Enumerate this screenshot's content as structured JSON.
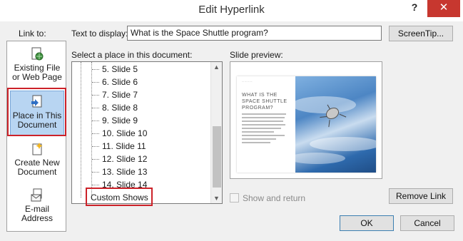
{
  "window": {
    "title": "Edit Hyperlink",
    "help_label": "?",
    "close_label": "✕"
  },
  "link_to": {
    "heading": "Link to:",
    "items": [
      {
        "label_line1": "Existing File",
        "label_line2": "or Web Page",
        "icon": "globe-file-icon",
        "selected": false
      },
      {
        "label_line1": "Place in This",
        "label_line2": "Document",
        "icon": "document-place-icon",
        "selected": true
      },
      {
        "label_line1": "Create New",
        "label_line2": "Document",
        "icon": "new-document-icon",
        "selected": false
      },
      {
        "label_line1": "E-mail",
        "label_line2": "Address",
        "icon": "email-icon",
        "selected": false
      }
    ]
  },
  "text_to_display": {
    "label": "Text to display:",
    "value": "What is the Space Shuttle program?"
  },
  "screentip_label": "ScreenTip...",
  "place_list": {
    "label": "Select a place in this document:",
    "items": [
      "5. Slide 5",
      "6. Slide 6",
      "7. Slide 7",
      "8. Slide 8",
      "9. Slide 9",
      "10. Slide 10",
      "11. Slide 11",
      "12. Slide 12",
      "13. Slide 13",
      "14. Slide 14"
    ],
    "custom_shows": "Custom Shows"
  },
  "preview": {
    "label": "Slide preview:",
    "slide_title": "WHAT IS THE SPACE SHUTTLE PROGRAM?"
  },
  "show_and_return": {
    "label": "Show and return",
    "checked": false,
    "enabled": false
  },
  "buttons": {
    "remove_link": "Remove Link",
    "ok": "OK",
    "cancel": "Cancel"
  },
  "colors": {
    "selection_bg": "#b8d5f2",
    "highlight_border": "#cc2229",
    "close_bg": "#c7372f"
  }
}
